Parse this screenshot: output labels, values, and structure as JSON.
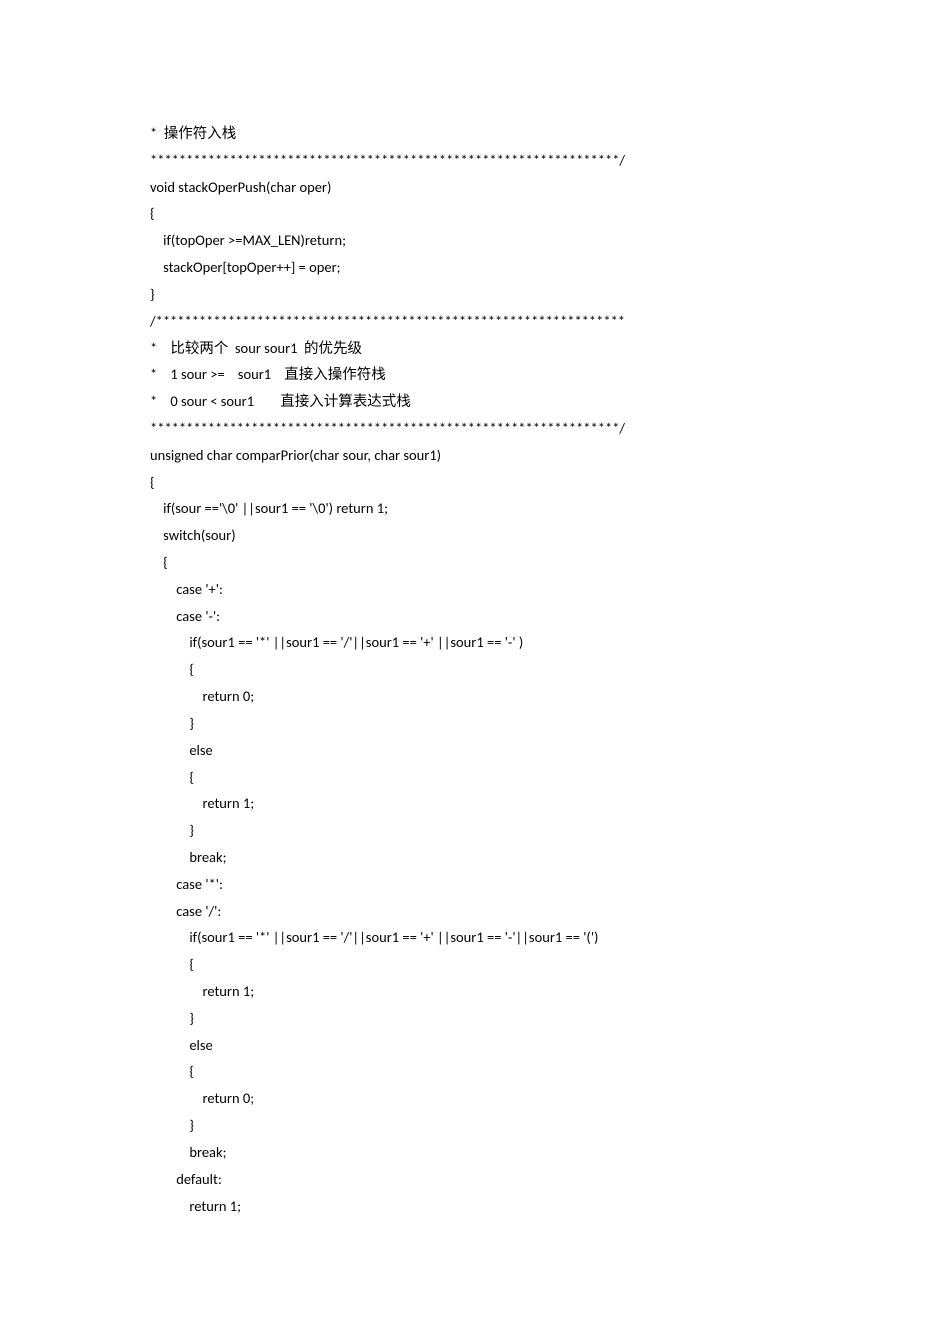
{
  "lines": [
    "*  操作符入栈",
    "*****************************************************************/",
    "",
    "void stackOperPush(char oper)",
    "{",
    "    if(topOper >=MAX_LEN)return;",
    "",
    "    stackOper[topOper++] = oper;",
    "}",
    "/*****************************************************************",
    "*    比较两个  sour sour1  的优先级",
    "*    1 sour >=    sour1    直接入操作符栈",
    "*    0 sour < sour1        直接入计算表达式栈",
    "*****************************************************************/",
    "unsigned char comparPrior(char sour, char sour1)",
    "{",
    "    if(sour =='\\0' ||sour1 == '\\0') return 1;",
    "",
    "    switch(sour)",
    "    {",
    "        case '+':",
    "        case '-':",
    "            if(sour1 == '*' ||sour1 == '/'||sour1 == '+' ||sour1 == '-' )",
    "            {",
    "                return 0;",
    "            }",
    "            else",
    "            {",
    "                return 1;",
    "            }",
    "            break;",
    "        case '*':",
    "        case '/':",
    "            if(sour1 == '*' ||sour1 == '/'||sour1 == '+' ||sour1 == '-'||sour1 == '(')",
    "            {",
    "                return 1;",
    "            }",
    "            else",
    "            {",
    "                return 0;",
    "            }",
    "            break;",
    "        default:",
    "            return 1;"
  ]
}
